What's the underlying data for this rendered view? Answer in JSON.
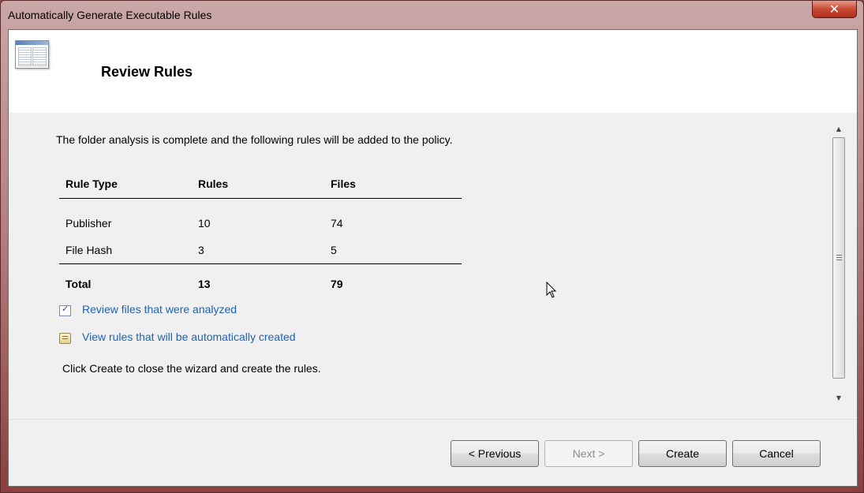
{
  "window": {
    "title": "Automatically Generate Executable Rules",
    "close_label": "✕"
  },
  "header": {
    "title": "Review Rules",
    "icon": "rules-wizard-icon"
  },
  "main": {
    "intro": "The folder analysis is complete and the following rules will be added to the policy.",
    "table": {
      "columns": [
        "Rule Type",
        "Rules",
        "Files"
      ],
      "rows": [
        [
          "Publisher",
          "10",
          "74"
        ],
        [
          "File Hash",
          "3",
          "5"
        ]
      ],
      "total": [
        "Total",
        "13",
        "79"
      ]
    },
    "links": [
      {
        "label": "Review files that were analyzed",
        "icon": "checklist-icon"
      },
      {
        "label": "View rules that will be automatically created",
        "icon": "scroll-icon"
      }
    ],
    "footer_text": "Click Create to close the wizard and create the rules."
  },
  "buttons": {
    "previous": "< Previous",
    "next": "Next >",
    "create": "Create",
    "cancel": "Cancel"
  },
  "colors": {
    "link": "#1c63b7",
    "disabled_text": "#8d8d8d"
  }
}
